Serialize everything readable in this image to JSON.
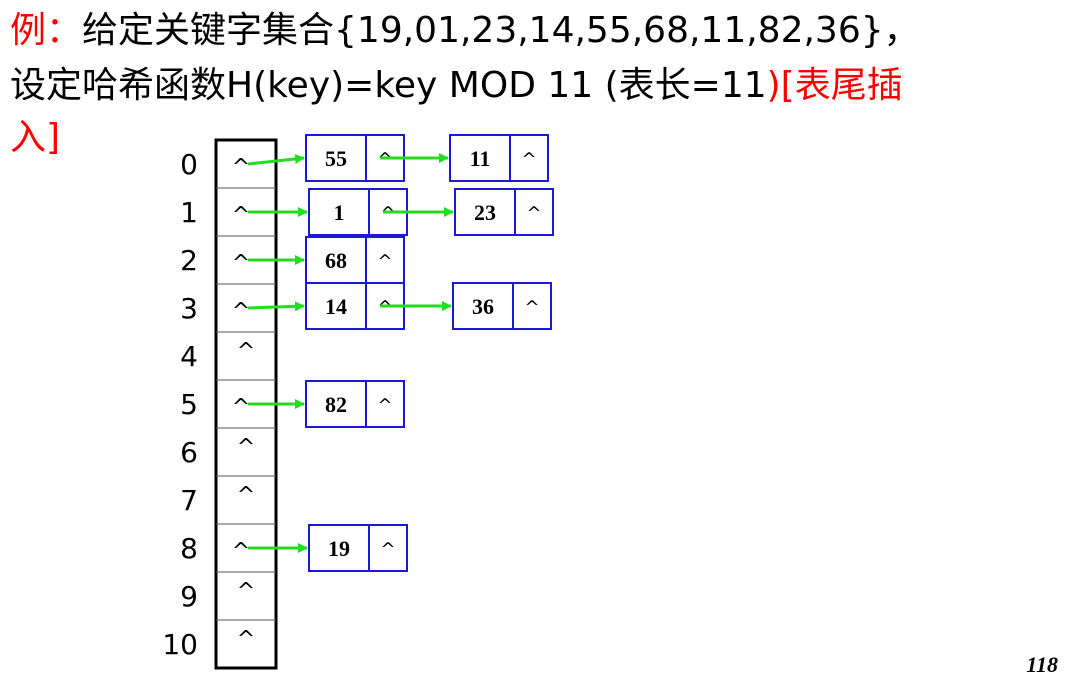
{
  "heading": {
    "example_label": "例：",
    "line1_text": "给定关键字集合{19,01,23,14,55,68,11,82,36}，",
    "line2_text": "设定哈希函数H(key)=key MOD 11 (表长=11",
    "line2_red": ")[表尾插",
    "line3_red": "入]"
  },
  "table": {
    "slots": [
      {
        "index": "0",
        "marker": "^",
        "chain": [
          {
            "key": "55",
            "next": "^"
          },
          {
            "key": "11",
            "next": "^"
          }
        ]
      },
      {
        "index": "1",
        "marker": "^",
        "chain": [
          {
            "key": "1",
            "next": "^"
          },
          {
            "key": "23",
            "next": "^"
          }
        ]
      },
      {
        "index": "2",
        "marker": "^",
        "chain": [
          {
            "key": "68",
            "next": "^"
          }
        ]
      },
      {
        "index": "3",
        "marker": "^",
        "chain": [
          {
            "key": "14",
            "next": "^"
          },
          {
            "key": "36",
            "next": "^"
          }
        ]
      },
      {
        "index": "4",
        "marker": "^",
        "chain": []
      },
      {
        "index": "5",
        "marker": "^",
        "chain": [
          {
            "key": "82",
            "next": "^"
          }
        ]
      },
      {
        "index": "6",
        "marker": "^",
        "chain": []
      },
      {
        "index": "7",
        "marker": "^",
        "chain": []
      },
      {
        "index": "8",
        "marker": "^",
        "chain": [
          {
            "key": "19",
            "next": "^"
          }
        ]
      },
      {
        "index": "9",
        "marker": "^",
        "chain": []
      },
      {
        "index": "10",
        "marker": "^",
        "chain": []
      }
    ]
  },
  "page_number": "118",
  "colors": {
    "node_border": "#1a1ad6",
    "arrow": "#22dd22",
    "emphasis": "#ff0000",
    "table_border": "#000000"
  }
}
